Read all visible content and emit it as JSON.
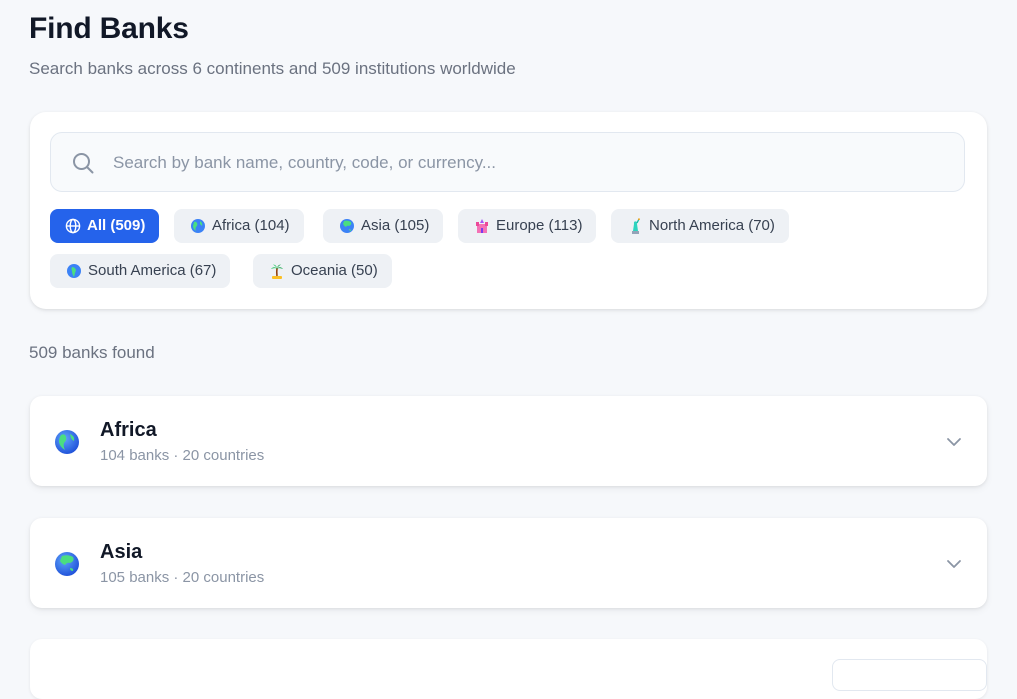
{
  "header": {
    "title": "Find Banks",
    "subtitle": "Search banks across 6 continents and 509 institutions worldwide"
  },
  "search": {
    "placeholder": "Search by bank name, country, code, or currency...",
    "value": ""
  },
  "filters": [
    {
      "label": "All (509)",
      "icon": "globe-outline-icon",
      "active": true
    },
    {
      "label": "Africa (104)",
      "icon": "globe-icon",
      "active": false
    },
    {
      "label": "Asia (105)",
      "icon": "globe-icon",
      "active": false
    },
    {
      "label": "Europe (113)",
      "icon": "castle-icon",
      "active": false
    },
    {
      "label": "North America (70)",
      "icon": "statue-of-liberty-icon",
      "active": false
    },
    {
      "label": "South America (67)",
      "icon": "globe-icon",
      "active": false
    },
    {
      "label": "Oceania (50)",
      "icon": "palm-tree-icon",
      "active": false
    }
  ],
  "results": {
    "count_text": "509 banks found"
  },
  "regions": [
    {
      "name": "Africa",
      "meta": "104 banks · 20 countries",
      "icon": "globe-icon",
      "expanded": false
    },
    {
      "name": "Asia",
      "meta": "105 banks · 20 countries",
      "icon": "globe-icon",
      "expanded": false
    }
  ],
  "colors": {
    "accent": "#2563eb",
    "background": "#f6f8fb",
    "chip_bg": "#eef1f5",
    "muted_text": "#6b7280"
  }
}
